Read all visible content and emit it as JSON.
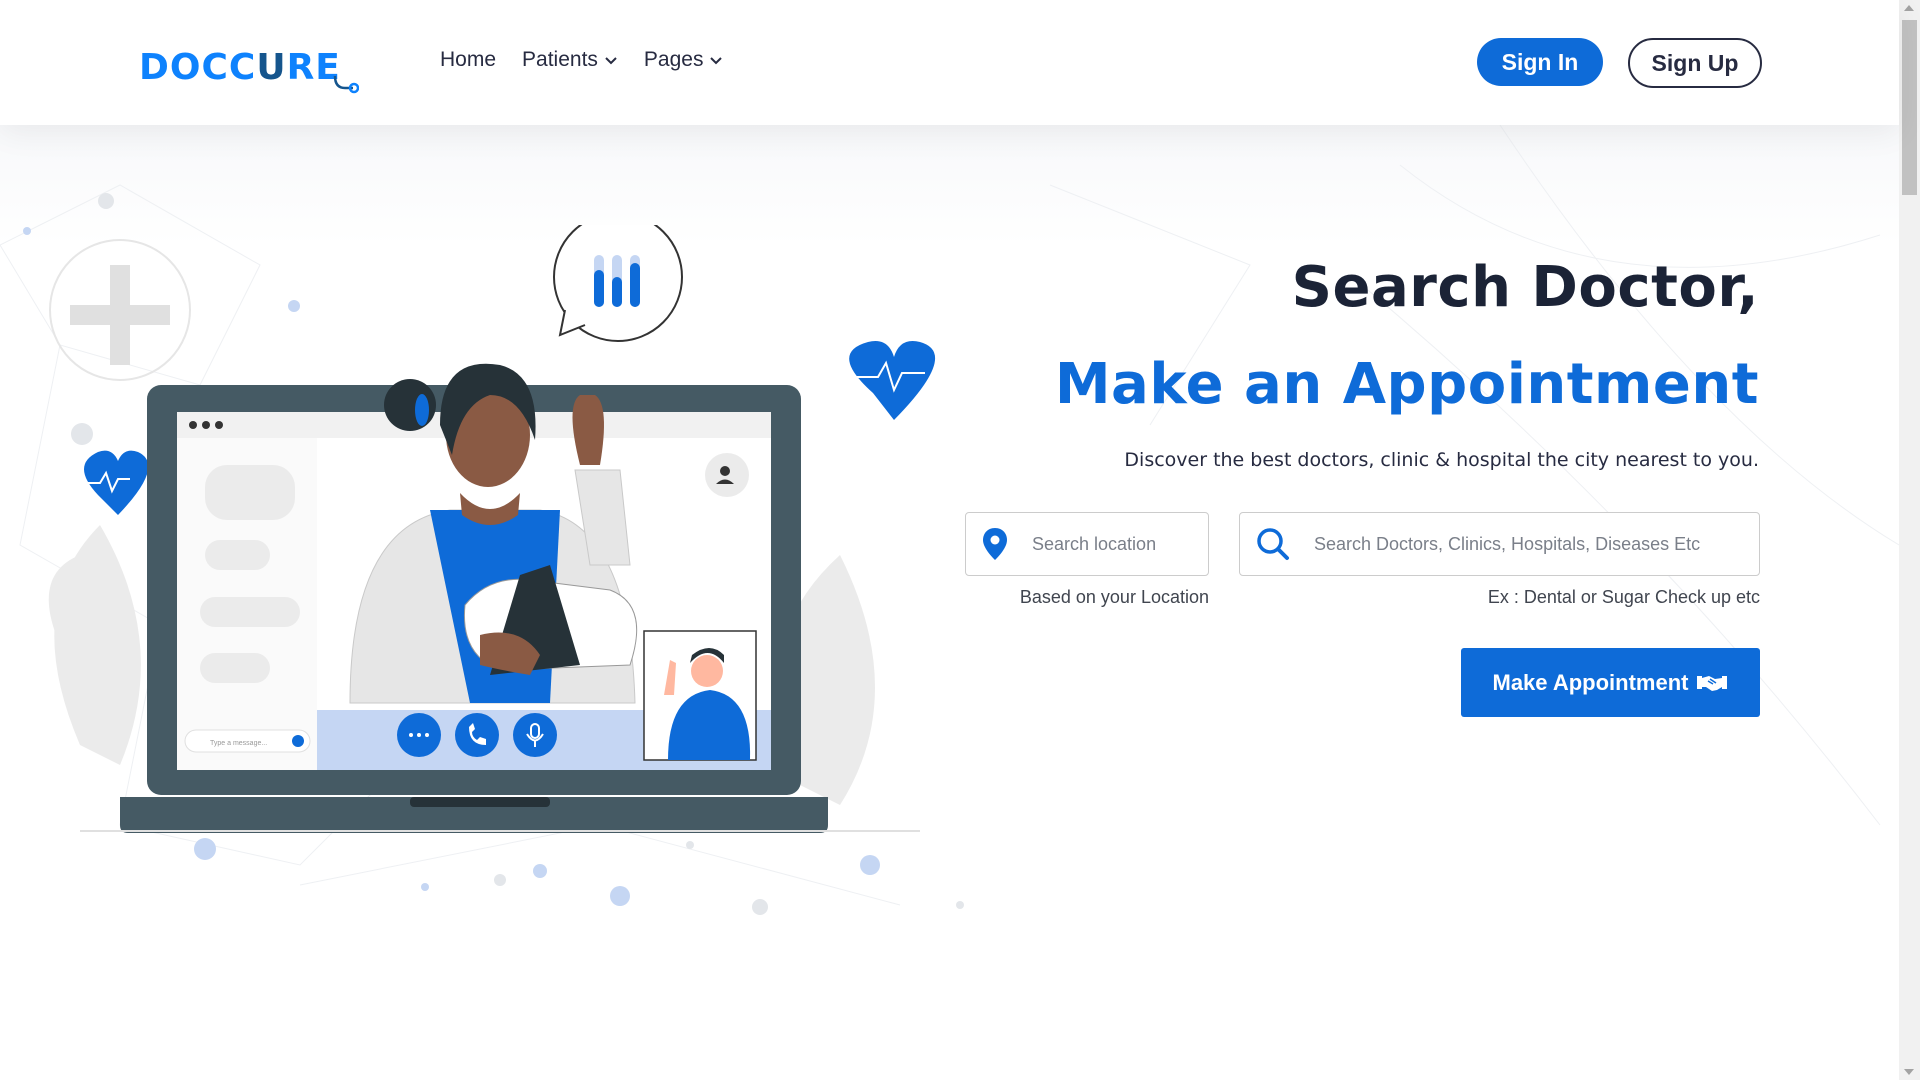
{
  "brand": {
    "logo_text_1": "DOCC",
    "logo_text_2": "U",
    "logo_text_3": "RE",
    "logo_icon": "stethoscope-icon"
  },
  "nav": {
    "items": [
      {
        "label": "Home"
      },
      {
        "label": "Patients",
        "icon": "chevron-down-icon"
      },
      {
        "label": "Pages",
        "icon": "chevron-down-icon"
      }
    ]
  },
  "auth": {
    "signin_label": "Sign In",
    "signup_label": "Sign Up"
  },
  "hero": {
    "title_line_1": "Search Doctor,",
    "title_line_2": "Make an Appointment",
    "subtitle": "Discover the best doctors, clinic & hospital the city nearest to you.",
    "location": {
      "placeholder": "Search location",
      "value": "",
      "hint": "Based on your Location",
      "icon": "map-pin-icon"
    },
    "search": {
      "placeholder": "Search Doctors, Clinics, Hospitals, Diseases Etc",
      "value": "",
      "hint": "Ex : Dental or Sugar Check up etc",
      "icon": "search-icon"
    },
    "appointment_button": "Make Appointment",
    "appointment_icon": "handshake-icon"
  },
  "illustration": {
    "chat_input_placeholder": "Type a message..."
  },
  "colors": {
    "primary": "#0e6bd8",
    "brand_blue": "#0e82fd",
    "dark": "#1b2336"
  }
}
